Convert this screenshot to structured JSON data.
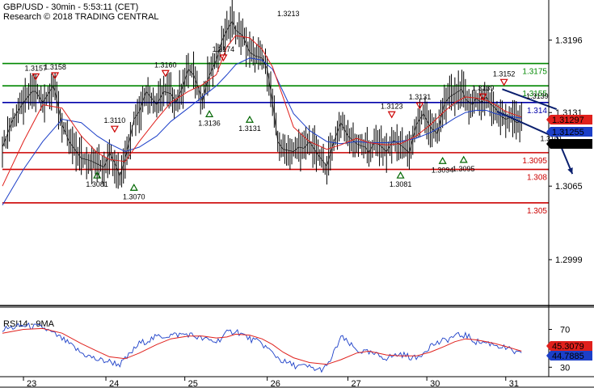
{
  "header": {
    "title": "GBP/USD - 30min - 5:53:11 (CET)",
    "subtitle": "Research © 2018 TRADING CENTRAL"
  },
  "rsi_panel": {
    "label": "RSI14 - 9MA",
    "ticks": [
      "70",
      "30"
    ]
  },
  "colors": {
    "background": "#ffffff",
    "price": "#000000",
    "ma_fast": "#e0201c",
    "ma_slow": "#1c3fc8",
    "support": "#cc0000",
    "resistance": "#008800",
    "pivot": "#0000aa",
    "up_marker": "#006600",
    "down_marker": "#cc0000"
  },
  "chart_data": [
    {
      "type": "line",
      "title": "GBP/USD - 30min",
      "ylim": [
        1.296,
        1.3232
      ],
      "xlim": [
        0,
        330
      ],
      "y_ticks": [
        "1.3196",
        "1.3131",
        "1.3065",
        "1.2999"
      ],
      "y_tick_values": [
        1.3196,
        1.3131,
        1.3065,
        1.2999
      ],
      "x_tick_labels": [
        "23",
        "24",
        "25",
        "26",
        "27",
        "30",
        "31"
      ],
      "x_tick_bars": [
        12,
        59,
        104,
        151,
        197,
        242,
        287
      ],
      "grid": false,
      "series": [
        {
          "kind": "price",
          "x": [
            0,
            6,
            12,
            17,
            19,
            23,
            29,
            30,
            34,
            38,
            45,
            50,
            54,
            58,
            61,
            64,
            67,
            70,
            73,
            75,
            78,
            82,
            86,
            88,
            92,
            96,
            99,
            103,
            106,
            109,
            112,
            114,
            117,
            119,
            122,
            125,
            128,
            131,
            133,
            137,
            141,
            144,
            148,
            151,
            154,
            157,
            160,
            163,
            166,
            169,
            172,
            175,
            180,
            185,
            189,
            193,
            197,
            202,
            205,
            207,
            209,
            212,
            215,
            219,
            223,
            227,
            232,
            236,
            240,
            244,
            248,
            252,
            255,
            258,
            262,
            264,
            268,
            270,
            273,
            276,
            278,
            281,
            284,
            287,
            290,
            293,
            296
          ],
          "values": [
            1.31,
            1.3125,
            1.314,
            1.315,
            1.315,
            1.314,
            1.3155,
            1.315,
            1.312,
            1.3105,
            1.309,
            1.3088,
            1.3085,
            1.3082,
            1.3095,
            1.3086,
            1.3074,
            1.309,
            1.311,
            1.3125,
            1.3132,
            1.315,
            1.3142,
            1.3138,
            1.315,
            1.3148,
            1.314,
            1.3155,
            1.317,
            1.3165,
            1.3152,
            1.3141,
            1.316,
            1.3168,
            1.3178,
            1.3195,
            1.3205,
            1.3213,
            1.3205,
            1.32,
            1.3185,
            1.3182,
            1.318,
            1.317,
            1.314,
            1.3105,
            1.3098,
            1.3097,
            1.3096,
            1.31,
            1.3099,
            1.3105,
            1.3093,
            1.3083,
            1.3105,
            1.3122,
            1.311,
            1.3103,
            1.3101,
            1.31,
            1.3095,
            1.3104,
            1.3102,
            1.3096,
            1.3106,
            1.3102,
            1.3095,
            1.312,
            1.313,
            1.3118,
            1.3112,
            1.3139,
            1.3145,
            1.3148,
            1.3152,
            1.3143,
            1.3138,
            1.3144,
            1.314,
            1.3145,
            1.3139,
            1.3135,
            1.3128,
            1.3125,
            1.3127,
            1.3122,
            1.3123
          ]
        },
        {
          "kind": "ma_fast",
          "x": [
            0,
            12,
            23,
            34,
            45,
            54,
            61,
            70,
            78,
            88,
            96,
            106,
            114,
            122,
            128,
            133,
            141,
            148,
            154,
            160,
            166,
            175,
            185,
            193,
            202,
            209,
            219,
            227,
            236,
            244,
            252,
            258,
            264,
            270,
            276,
            281,
            287,
            296
          ],
          "values": [
            1.3065,
            1.3105,
            1.3138,
            1.3135,
            1.311,
            1.3095,
            1.3089,
            1.3087,
            1.3105,
            1.3125,
            1.314,
            1.315,
            1.3156,
            1.3165,
            1.319,
            1.32,
            1.3198,
            1.3188,
            1.3172,
            1.3145,
            1.3118,
            1.3105,
            1.3098,
            1.3102,
            1.3108,
            1.3104,
            1.3102,
            1.3103,
            1.311,
            1.312,
            1.3132,
            1.314,
            1.3145,
            1.3144,
            1.3142,
            1.3138,
            1.3132,
            1.3127
          ]
        },
        {
          "kind": "ma_slow",
          "x": [
            0,
            12,
            23,
            34,
            45,
            54,
            61,
            70,
            78,
            88,
            96,
            106,
            114,
            122,
            128,
            133,
            141,
            148,
            154,
            160,
            166,
            175,
            185,
            193,
            202,
            209,
            219,
            227,
            236,
            244,
            252,
            258,
            264,
            270,
            276,
            281,
            287,
            296
          ],
          "values": [
            1.3048,
            1.308,
            1.3105,
            1.3125,
            1.3122,
            1.311,
            1.3103,
            1.3096,
            1.31,
            1.311,
            1.3123,
            1.3135,
            1.3145,
            1.3155,
            1.3165,
            1.3174,
            1.318,
            1.3178,
            1.317,
            1.315,
            1.313,
            1.3115,
            1.3105,
            1.3103,
            1.3105,
            1.3104,
            1.3104,
            1.3105,
            1.3108,
            1.3113,
            1.312,
            1.3126,
            1.3131,
            1.3133,
            1.3133,
            1.313,
            1.3128,
            1.3126
          ]
        }
      ],
      "levels": [
        {
          "value": 1.3175,
          "label": "1.3175",
          "role": "resistance"
        },
        {
          "value": 1.3155,
          "label": "1.3155",
          "role": "resistance"
        },
        {
          "value": 1.314,
          "label": "1.314",
          "role": "pivot"
        },
        {
          "value": 1.3095,
          "label": "1.3095",
          "role": "support"
        },
        {
          "value": 1.308,
          "label": "1.308",
          "role": "support"
        },
        {
          "value": 1.305,
          "label": "1.305",
          "role": "support"
        }
      ],
      "right_tags": [
        {
          "text": "1.31297",
          "bg": "#e0201c"
        },
        {
          "text": "1.31255",
          "bg": "#1c3fc8"
        },
        {
          "text": "1.3123",
          "bg": "#000000"
        }
      ],
      "markers": [
        {
          "x": 19,
          "value": 1.3157,
          "label": "1.3157",
          "dir": "down"
        },
        {
          "x": 30,
          "value": 1.3158,
          "label": "1.3158",
          "dir": "down"
        },
        {
          "x": 54,
          "value": 1.3081,
          "label": "1.3081",
          "dir": "up"
        },
        {
          "x": 64,
          "value": 1.311,
          "label": "1.3110",
          "dir": "down"
        },
        {
          "x": 75,
          "value": 1.307,
          "label": "1.3070",
          "dir": "up"
        },
        {
          "x": 93,
          "value": 1.316,
          "label": "1.3160",
          "dir": "down"
        },
        {
          "x": 118,
          "value": 1.3136,
          "label": "1.3136",
          "dir": "up"
        },
        {
          "x": 126,
          "value": 1.3174,
          "label": "1.3174",
          "dir": "down"
        },
        {
          "x": 141,
          "value": 1.3131,
          "label": "1.3131",
          "dir": "up"
        },
        {
          "x": 163,
          "value": 1.3213,
          "label": "1.3213",
          "dir": "none"
        },
        {
          "x": 222,
          "value": 1.3123,
          "label": "1.3123",
          "dir": "down"
        },
        {
          "x": 227,
          "value": 1.3081,
          "label": "1.3081",
          "dir": "up"
        },
        {
          "x": 238,
          "value": 1.3131,
          "label": "1.3131",
          "dir": "down"
        },
        {
          "x": 251,
          "value": 1.3094,
          "label": "1.3094",
          "dir": "up"
        },
        {
          "x": 263,
          "value": 1.3095,
          "label": "1.3095",
          "dir": "up"
        },
        {
          "x": 274,
          "value": 1.3139,
          "label": "1.3139",
          "dir": "down"
        },
        {
          "x": 286,
          "value": 1.3152,
          "label": "1.3152",
          "dir": "down"
        },
        {
          "x": 305,
          "value": 1.3139,
          "label": "1.3139",
          "dir": "none"
        },
        {
          "x": 313,
          "value": 1.3101,
          "label": "1.3101",
          "dir": "none"
        }
      ],
      "channel": {
        "upper": {
          "x": [
            285,
            316
          ],
          "values": [
            1.3152,
            1.3134
          ]
        },
        "lower": {
          "x": [
            282,
            312
          ],
          "values": [
            1.3132,
            1.3111
          ]
        }
      },
      "forecast_arrow": {
        "x": [
          316,
          325
        ],
        "values": [
          1.311,
          1.3076
        ]
      }
    },
    {
      "type": "line",
      "title": "RSI14 - 9MA",
      "ylim": [
        20,
        85
      ],
      "xlim": [
        0,
        330
      ],
      "y_ticks": [
        "70",
        "30"
      ],
      "y_tick_values": [
        70,
        30
      ],
      "x_tick_labels": [
        "23",
        "24",
        "25",
        "26",
        "27",
        "30",
        "31"
      ],
      "grid": false,
      "series": [
        {
          "kind": "rsi",
          "x": [
            0,
            12,
            23,
            34,
            45,
            54,
            61,
            67,
            70,
            78,
            88,
            96,
            106,
            114,
            122,
            128,
            133,
            141,
            148,
            154,
            160,
            166,
            175,
            180,
            185,
            189,
            193,
            202,
            209,
            219,
            227,
            236,
            244,
            252,
            258,
            264,
            270,
            276,
            281,
            287,
            296
          ],
          "values": [
            70,
            74,
            72,
            60,
            45,
            38,
            36,
            33,
            38,
            55,
            62,
            64,
            65,
            60,
            57,
            66,
            69,
            60,
            55,
            45,
            36,
            32,
            30,
            27,
            30,
            45,
            62,
            48,
            45,
            40,
            44,
            39,
            53,
            58,
            63,
            64,
            57,
            56,
            54,
            50,
            43
          ]
        },
        {
          "kind": "rsi_ma",
          "x": [
            0,
            12,
            23,
            34,
            45,
            54,
            61,
            70,
            78,
            88,
            96,
            106,
            114,
            122,
            128,
            133,
            141,
            148,
            154,
            160,
            166,
            175,
            185,
            193,
            202,
            209,
            219,
            227,
            236,
            244,
            252,
            258,
            264,
            270,
            276,
            281,
            287,
            296
          ],
          "values": [
            66,
            70,
            71,
            66,
            55,
            47,
            41,
            39,
            45,
            54,
            60,
            63,
            63,
            61,
            62,
            65,
            64,
            60,
            54,
            46,
            40,
            35,
            33,
            38,
            45,
            47,
            43,
            42,
            42,
            46,
            52,
            57,
            60,
            59,
            57,
            55,
            52,
            47
          ]
        }
      ],
      "right_tags": [
        {
          "text": "45.3079",
          "bg": "#e0201c"
        },
        {
          "text": "44.7885",
          "bg": "#1c3fc8"
        }
      ]
    }
  ]
}
